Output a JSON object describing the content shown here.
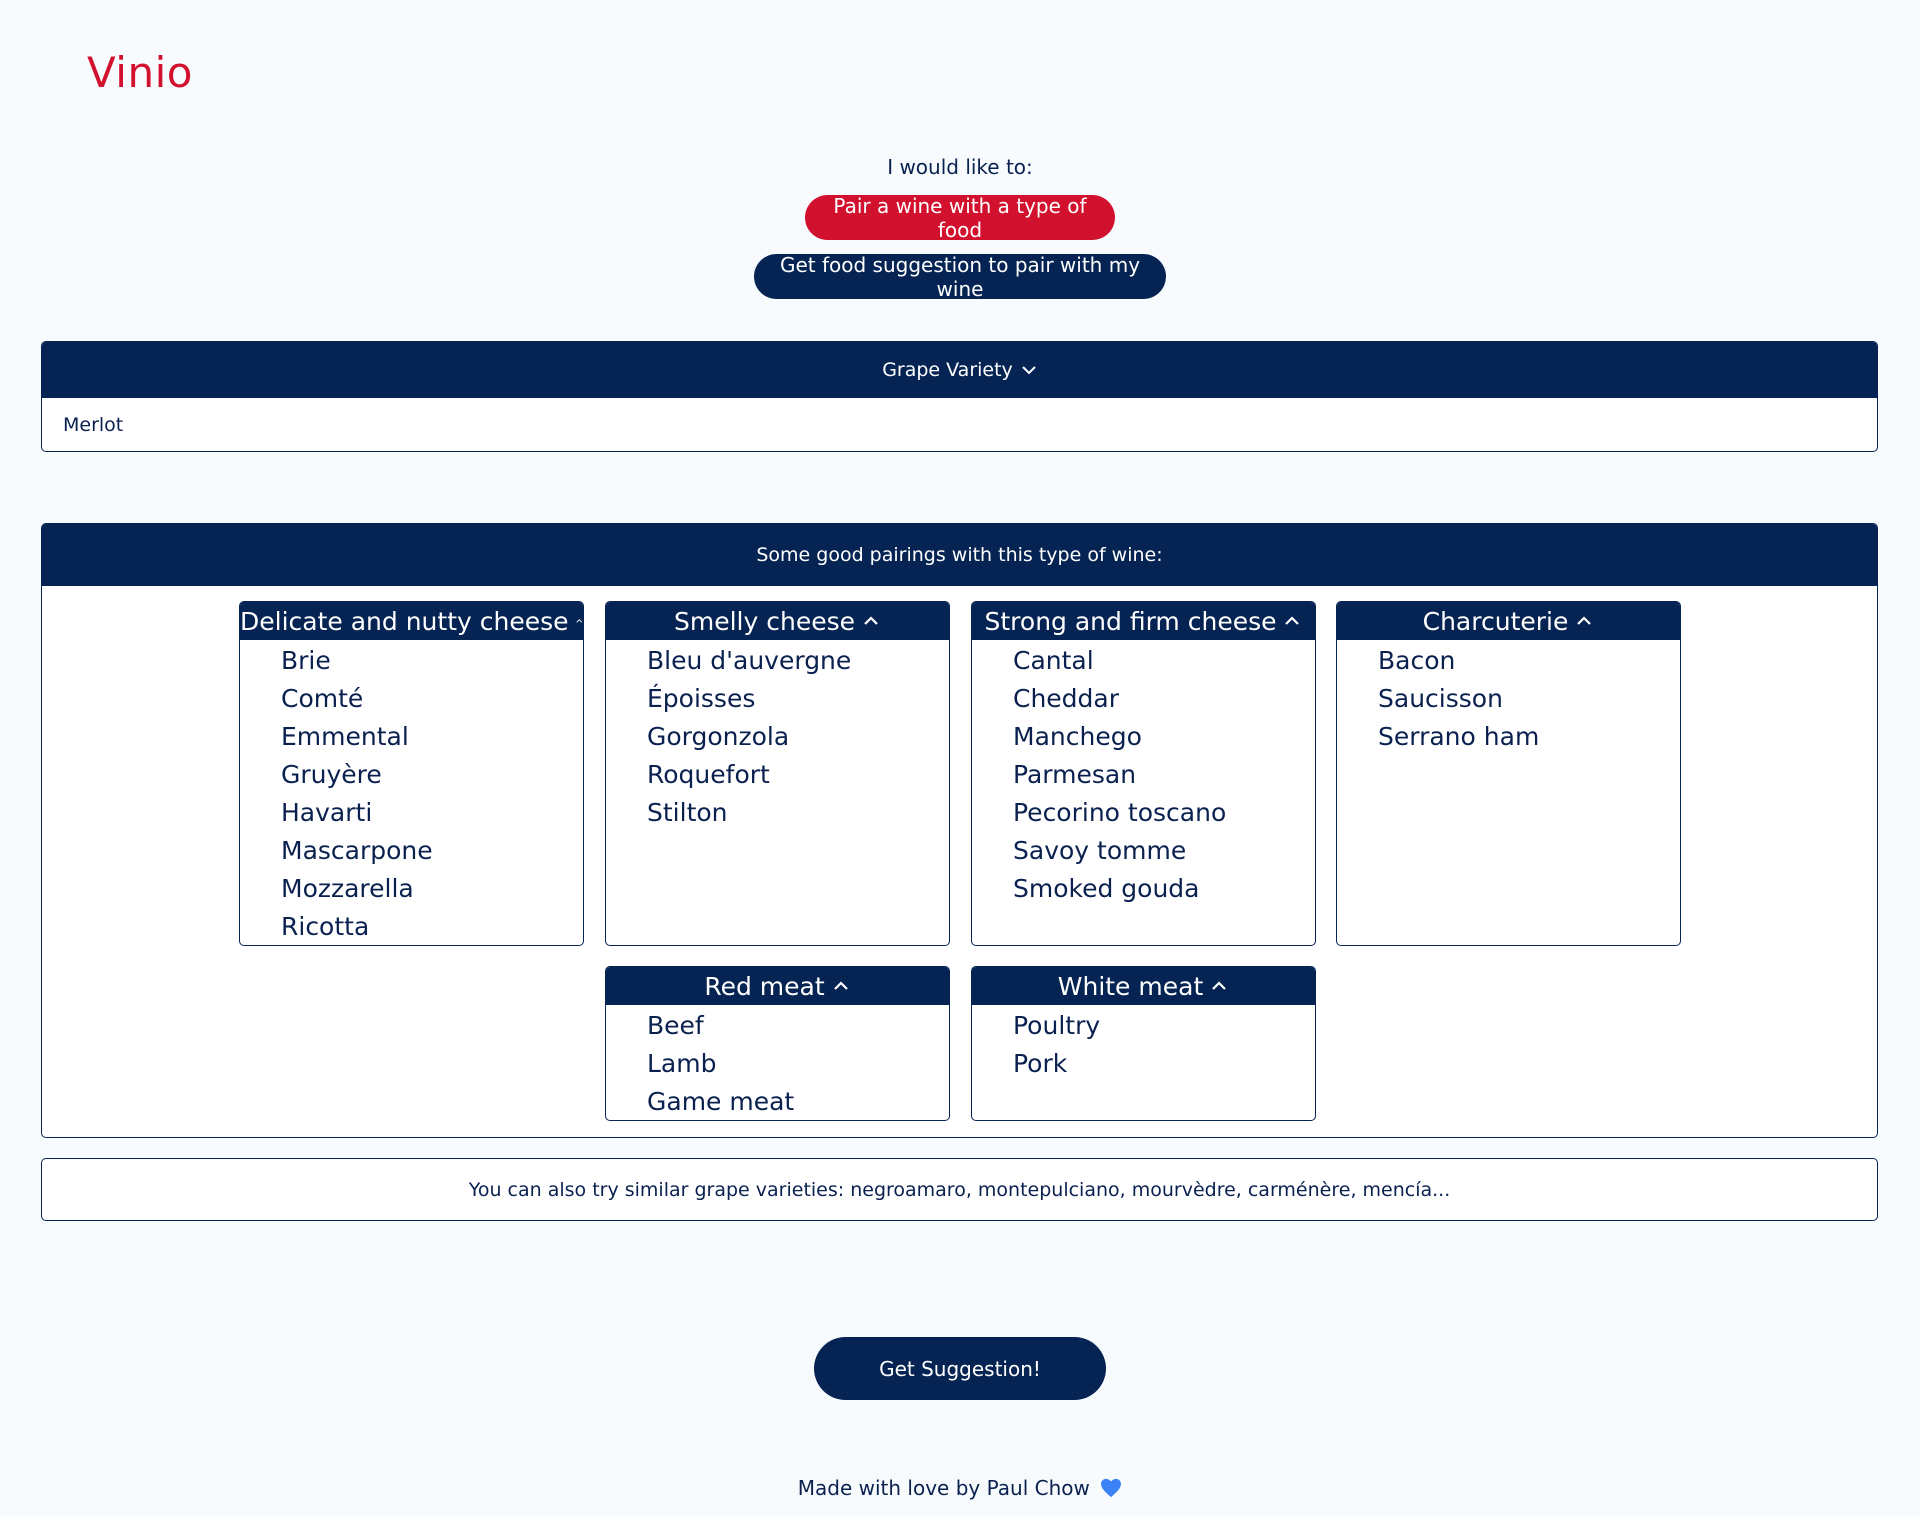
{
  "app": {
    "title": "Vinio"
  },
  "mode": {
    "prompt": "I would like to:",
    "options": [
      {
        "label": "Pair a wine with a type of food",
        "active": true
      },
      {
        "label": "Get food suggestion to pair with my wine",
        "active": false
      }
    ]
  },
  "grape": {
    "header": "Grape Variety",
    "selected": "Merlot"
  },
  "pairings": {
    "header": "Some good pairings with this type of wine:",
    "categories": [
      {
        "name": "Delicate and nutty cheese",
        "items": [
          "Brie",
          "Comté",
          "Emmental",
          "Gruyère",
          "Havarti",
          "Mascarpone",
          "Mozzarella",
          "Ricotta"
        ]
      },
      {
        "name": "Smelly cheese",
        "items": [
          "Bleu d'auvergne",
          "Époisses",
          "Gorgonzola",
          "Roquefort",
          "Stilton"
        ]
      },
      {
        "name": "Strong and firm cheese",
        "items": [
          "Cantal",
          "Cheddar",
          "Manchego",
          "Parmesan",
          "Pecorino toscano",
          "Savoy tomme",
          "Smoked gouda"
        ]
      },
      {
        "name": "Charcuterie",
        "items": [
          "Bacon",
          "Saucisson",
          "Serrano ham"
        ]
      },
      {
        "name": "Red meat",
        "items": [
          "Beef",
          "Lamb",
          "Game meat"
        ]
      },
      {
        "name": "White meat",
        "items": [
          "Poultry",
          "Pork"
        ]
      }
    ]
  },
  "similar": {
    "text": "You can also try similar grape varieties: negroamaro, montepulciano, mourvèdre, carménère, mencía..."
  },
  "actions": {
    "suggest_label": "Get Suggestion!"
  },
  "footer": {
    "text": "Made with love by Paul Chow",
    "icon": "blue-heart-icon"
  },
  "colors": {
    "accent_red": "#d2112f",
    "navy": "#052453",
    "background": "#f7fbfd",
    "heart": "#3b82f6"
  }
}
